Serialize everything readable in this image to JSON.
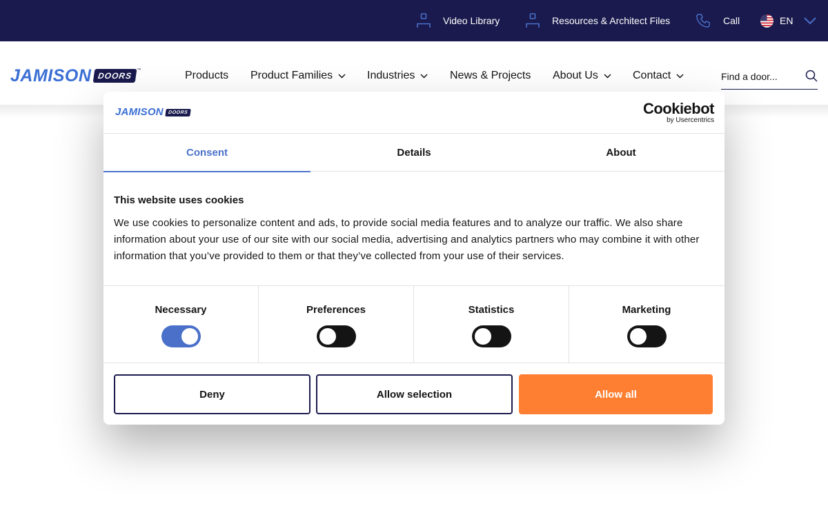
{
  "topbar": {
    "video_label": "Video Library",
    "resources_label": "Resources & Architect Files",
    "call_label": "Call",
    "language_label": "EN"
  },
  "header": {
    "logo_word": "JAMISON",
    "logo_badge": "DOORS",
    "logo_tm": "™",
    "nav": {
      "products": "Products",
      "product_families": "Product Families",
      "industries": "Industries",
      "news_projects": "News & Projects",
      "about_us": "About Us",
      "contact": "Contact"
    },
    "search_placeholder": "Find a door..."
  },
  "cookie_dialog": {
    "logo_word": "JAMISON",
    "logo_badge": "DOORS",
    "brand_name": "Cookiebot",
    "brand_sub": "by Usercentrics",
    "tabs": {
      "consent": "Consent",
      "details": "Details",
      "about": "About"
    },
    "active_tab": "Consent",
    "title": "This website uses cookies",
    "body": "We use cookies to personalize content and ads, to provide social media features and to analyze our traffic. We also share information about your use of our site with our social media, advertising and analytics partners who may combine it with other information that you’ve provided to them or that they’ve collected from your use of their services.",
    "categories": {
      "necessary": {
        "label": "Necessary",
        "enabled": true
      },
      "preferences": {
        "label": "Preferences",
        "enabled": false
      },
      "statistics": {
        "label": "Statistics",
        "enabled": false
      },
      "marketing": {
        "label": "Marketing",
        "enabled": false
      }
    },
    "buttons": {
      "deny": "Deny",
      "allow_selection": "Allow selection",
      "allow_all": "Allow all"
    }
  },
  "colors": {
    "navy": "#1a1a4e",
    "brand_blue": "#3b6fd4",
    "accent_blue": "#4a70c9",
    "orange": "#ff7f32"
  },
  "icons": {
    "video": "person-icon",
    "resources": "person-icon",
    "call": "phone-icon",
    "language": "us-flag-icon",
    "search": "search-icon",
    "dropdown": "chevron-down-icon"
  }
}
